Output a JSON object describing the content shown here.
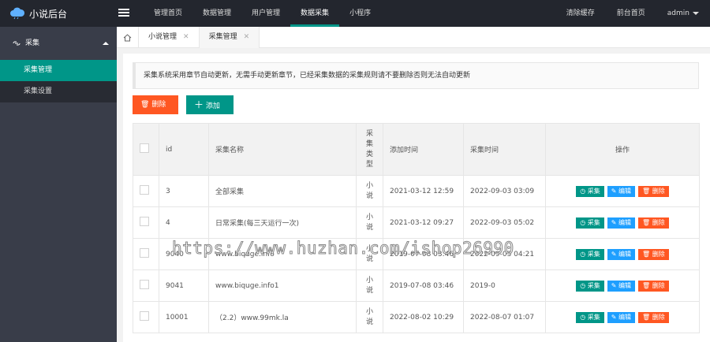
{
  "app": {
    "title": "小说后台"
  },
  "topnav": [
    {
      "label": "管理首页"
    },
    {
      "label": "数据管理"
    },
    {
      "label": "用户管理"
    },
    {
      "label": "数据采集"
    },
    {
      "label": "小程序"
    }
  ],
  "topright": {
    "clear_cache": "清除缓存",
    "front_home": "前台首页",
    "user": "admin"
  },
  "sidebar": {
    "group": "采集",
    "items": [
      {
        "label": "采集管理"
      },
      {
        "label": "采集设置"
      }
    ]
  },
  "tabs": [
    {
      "label": "小说管理"
    },
    {
      "label": "采集管理"
    }
  ],
  "notice": "采集系统采用章节自动更新，无需手动更新章节，已经采集数据的采集规则请不要删除否则无法自动更新",
  "buttons": {
    "delete": "删除",
    "add": "添加"
  },
  "table": {
    "headers": {
      "id": "id",
      "name": "采集名称",
      "type": "采集类型",
      "add_time": "添加时间",
      "collect_time": "采集时间",
      "actions": "操作"
    },
    "rows": [
      {
        "id": "3",
        "name": "全部采集",
        "type": "小说",
        "add_time": "2021-03-12 12:59",
        "collect_time": "2022-09-03 03:09"
      },
      {
        "id": "4",
        "name": "日常采集(每三天运行一次)",
        "type": "小说",
        "add_time": "2021-03-12 09:27",
        "collect_time": "2022-09-03 05:02"
      },
      {
        "id": "9040",
        "name": "www.biquge.info",
        "type": "小说",
        "add_time": "2019-07-08 03:46",
        "collect_time": "2022-09-03 04:21"
      },
      {
        "id": "9041",
        "name": "www.biquge.info1",
        "type": "小说",
        "add_time": "2019-07-08 03:46",
        "collect_time": "2019-0"
      },
      {
        "id": "10001",
        "name": "（2.2）www.99mk.la",
        "type": "小说",
        "add_time": "2022-08-02 10:29",
        "collect_time": "2022-08-07 01:07"
      }
    ],
    "row_actions": {
      "collect": "采集",
      "edit": "编辑",
      "delete": "删除"
    }
  },
  "watermark": "https://www.huzhan.com/ishop26990"
}
